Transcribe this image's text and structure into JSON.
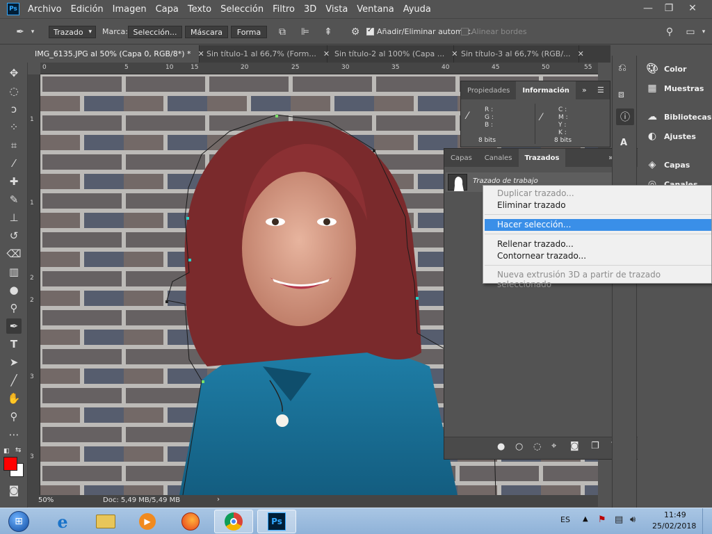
{
  "app": {
    "logo": "Ps"
  },
  "menu": [
    "Archivo",
    "Edición",
    "Imagen",
    "Capa",
    "Texto",
    "Selección",
    "Filtro",
    "3D",
    "Vista",
    "Ventana",
    "Ayuda"
  ],
  "options": {
    "mode_select": "Trazado",
    "marca_label": "Marca:",
    "seleccion_btn": "Selección...",
    "mascara_btn": "Máscara",
    "forma_btn": "Forma",
    "auto_add_label": "Añadir/Eliminar automát.",
    "align_edges_label": "Alinear bordes"
  },
  "tabs": [
    {
      "label": "IMG_6135.JPG al 50% (Capa 0, RGB/8*) *",
      "active": true
    },
    {
      "label": "Sin título-1 al 66,7% (Form...",
      "active": false
    },
    {
      "label": "Sin título-2 al 100% (Capa ...",
      "active": false
    },
    {
      "label": "Sin título-3 al 66,7% (RGB/...",
      "active": false
    }
  ],
  "ruler": {
    "top": [
      "0",
      "5",
      "10",
      "15",
      "20",
      "25",
      "30",
      "35",
      "40",
      "45",
      "50",
      "55"
    ],
    "left": [
      "1",
      "1",
      "2",
      "2",
      "3",
      "3"
    ]
  },
  "status": {
    "zoom": "50%",
    "doc": "Doc: 5,49 MB/5,49 MB"
  },
  "colors": {
    "foreground": "#ff0000",
    "background": "#ffffff",
    "accent": "#3a8fe8"
  },
  "info_panel": {
    "tabs": [
      "Propiedades",
      "Información"
    ],
    "rgb_labels": [
      "R :",
      "G :",
      "B :"
    ],
    "cmyk_labels": [
      "C :",
      "M :",
      "Y :",
      "K :"
    ],
    "bits_left": "8 bits",
    "bits_right": "8 bits"
  },
  "paths_panel": {
    "tabs": [
      "Capas",
      "Canales",
      "Trazados"
    ],
    "item": "Trazado de trabajo"
  },
  "dock": {
    "items": [
      "Color",
      "Muestras",
      "Bibliotecas",
      "Ajustes",
      "Capas",
      "Canales"
    ]
  },
  "context_menu": {
    "items": [
      {
        "label": "Duplicar trazado...",
        "disabled": true
      },
      {
        "label": "Eliminar trazado",
        "disabled": false
      },
      {
        "label": "Hacer selección...",
        "disabled": false,
        "highlighted": true
      },
      {
        "label": "Rellenar trazado...",
        "disabled": false
      },
      {
        "label": "Contornear trazado...",
        "disabled": false
      },
      {
        "label": "Nueva extrusión 3D a partir de trazado seleccionado",
        "disabled": true
      }
    ]
  },
  "taskbar": {
    "lang": "ES",
    "time": "11:49",
    "date": "25/02/2018"
  }
}
